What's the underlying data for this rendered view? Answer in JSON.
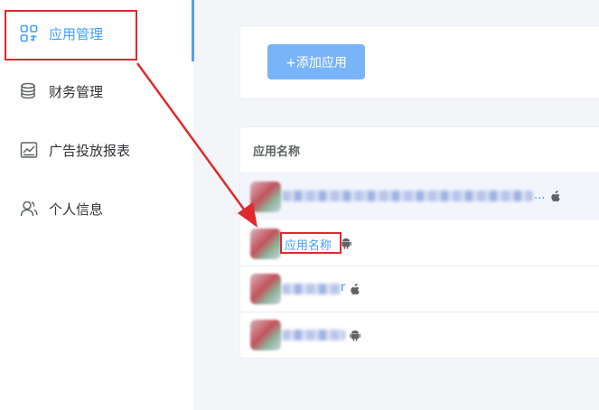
{
  "sidebar": {
    "items": [
      {
        "label": "应用管理",
        "icon": "grid-apps-icon",
        "active": true
      },
      {
        "label": "财务管理",
        "icon": "coins-stack-icon",
        "active": false
      },
      {
        "label": "广告投放报表",
        "icon": "chart-report-icon",
        "active": false
      },
      {
        "label": "个人信息",
        "icon": "users-icon",
        "active": false
      }
    ]
  },
  "toolbar": {
    "add_label": "+添加应用"
  },
  "table": {
    "header": "应用名称",
    "rows": [
      {
        "name": "",
        "truncated_suffix": "...",
        "platform": "apple-icon",
        "blurred": true
      },
      {
        "name": "应用名称",
        "platform": "android-icon",
        "blurred": false
      },
      {
        "name": "r",
        "platform": "apple-icon",
        "blurred": true
      },
      {
        "name": "",
        "platform": "android-icon",
        "blurred": true
      }
    ]
  },
  "colors": {
    "accent": "#409eff",
    "button": "#79b4f8",
    "annotation": "#e0292d",
    "background": "#f4f5f8"
  }
}
